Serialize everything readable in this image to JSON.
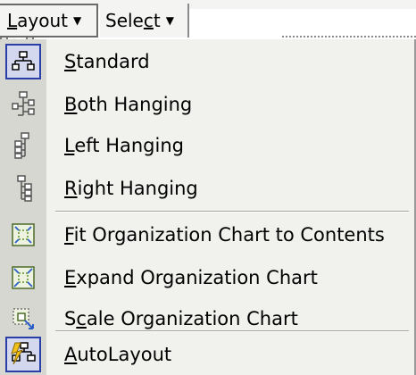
{
  "toolbar": {
    "layout_label": "Layout",
    "select_label": "Select",
    "autoformat_icon": "autoformat-icon",
    "fit_text_icon": "fit-text-icon"
  },
  "menu": {
    "items": [
      {
        "label": "Standard",
        "icon": "org-standard-icon",
        "mnemonic": "S",
        "active": true
      },
      {
        "label": "Both Hanging",
        "icon": "org-both-hanging-icon",
        "mnemonic": "B"
      },
      {
        "label": "Left Hanging",
        "icon": "org-left-hanging-icon",
        "mnemonic": "L"
      },
      {
        "label": "Right Hanging",
        "icon": "org-right-hanging-icon",
        "mnemonic": "R"
      },
      {
        "label": "Fit Organization Chart to Contents",
        "icon": "fit-contents-icon",
        "mnemonic": "F"
      },
      {
        "label": "Expand Organization Chart",
        "icon": "expand-chart-icon",
        "mnemonic": "E"
      },
      {
        "label": "Scale Organization Chart",
        "icon": "scale-chart-icon",
        "mnemonic": "c"
      },
      {
        "label": "AutoLayout",
        "icon": "autolayout-icon",
        "mnemonic": "A"
      }
    ]
  },
  "colors": {
    "menu_bg": "#f1f1ee",
    "gutter_bg": "#d7d7d1",
    "active_border": "#2a3ea8",
    "active_bg": "#d4d8ef"
  }
}
